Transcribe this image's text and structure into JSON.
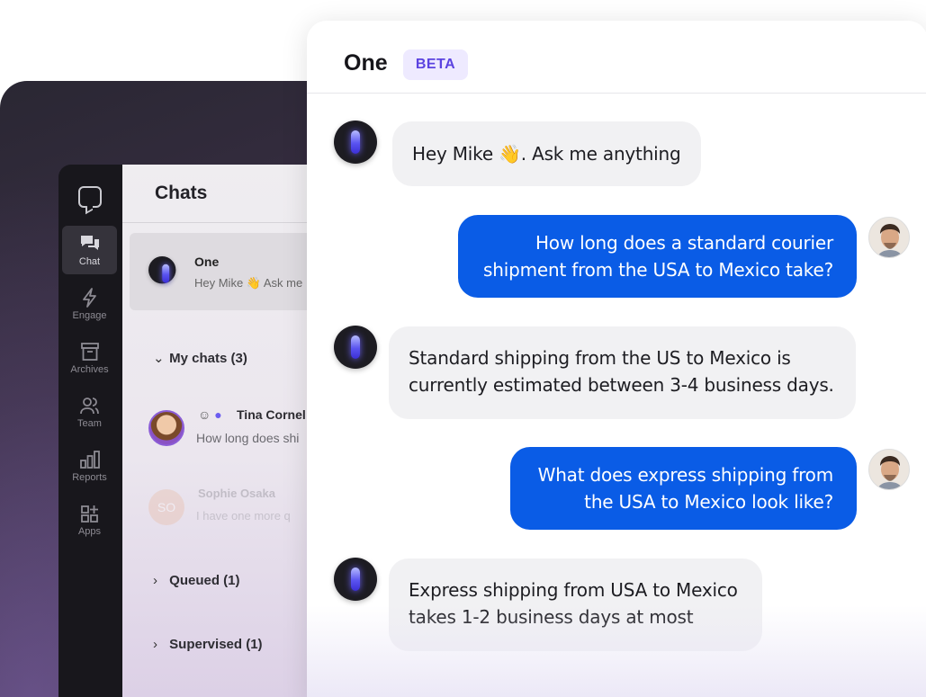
{
  "sidebar": {
    "items": [
      {
        "label": "Chat",
        "icon": "chat-icon",
        "active": true
      },
      {
        "label": "Engage",
        "icon": "lightning-icon",
        "active": false
      },
      {
        "label": "Archives",
        "icon": "archive-icon",
        "active": false
      },
      {
        "label": "Team",
        "icon": "team-icon",
        "active": false
      },
      {
        "label": "Reports",
        "icon": "reports-icon",
        "active": false
      },
      {
        "label": "Apps",
        "icon": "apps-icon",
        "active": false
      }
    ]
  },
  "chat_list": {
    "title": "Chats",
    "pinned": {
      "name": "One",
      "preview": "Hey Mike 👋 Ask me"
    },
    "sections": [
      {
        "label": "My chats (3)",
        "expanded": true
      },
      {
        "label": "Queued (1)",
        "expanded": false
      },
      {
        "label": "Supervised (1)",
        "expanded": false
      }
    ],
    "chats": [
      {
        "name": "Tina Cornel",
        "preview": "How long does shi"
      },
      {
        "name": "Sophie Osaka",
        "preview": "I have one more q",
        "initials": "SO"
      }
    ]
  },
  "conversation": {
    "title": "One",
    "badge": "BETA",
    "messages": [
      {
        "from": "bot",
        "text": "Hey Mike 👋. Ask me anything"
      },
      {
        "from": "user",
        "lines": [
          "How long does a standard courier",
          "shipment from the USA to Mexico take?"
        ]
      },
      {
        "from": "bot",
        "lines": [
          "Standard shipping from the US to Mexico is",
          "currently estimated between 3-4 business days."
        ]
      },
      {
        "from": "user",
        "lines": [
          "What does express shipping from",
          "the USA to Mexico look like?"
        ]
      },
      {
        "from": "bot",
        "lines": [
          "Express shipping from USA to Mexico",
          "takes 1-2 business days at most"
        ]
      }
    ]
  },
  "colors": {
    "accent": "#0a5ce6",
    "badge": "#5b43e0"
  }
}
